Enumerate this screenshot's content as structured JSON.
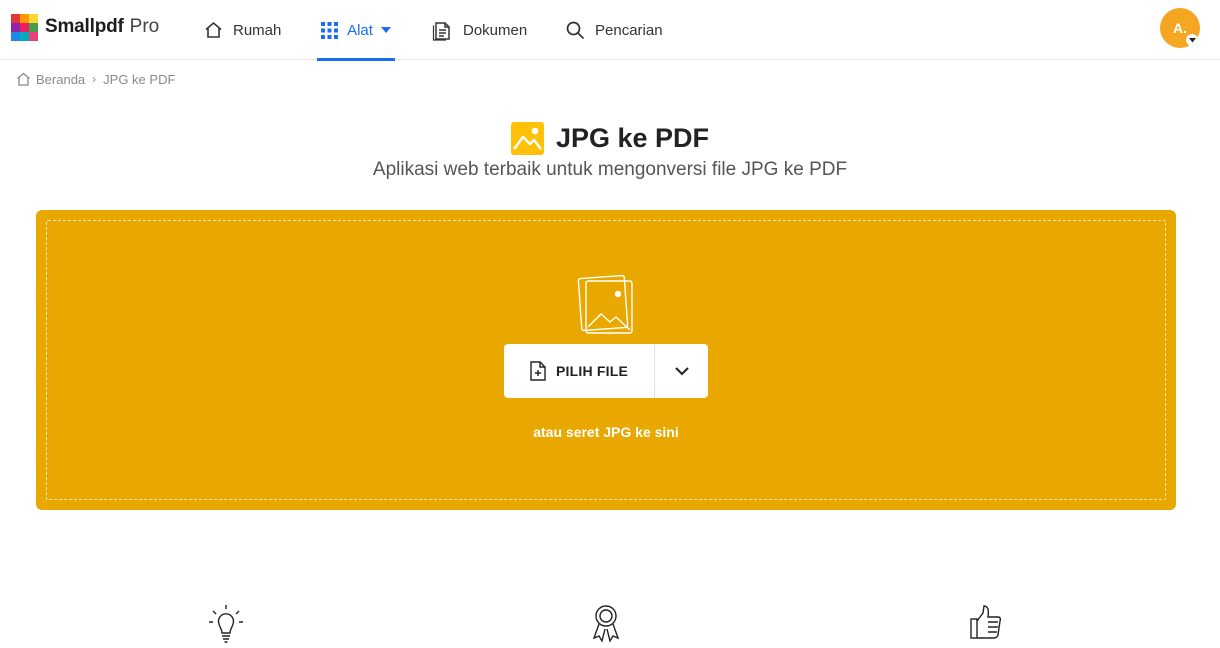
{
  "brand": {
    "name": "Smallpdf",
    "tier": "Pro"
  },
  "nav": {
    "items": [
      {
        "label": "Rumah",
        "icon": "home-icon"
      },
      {
        "label": "Alat",
        "icon": "grid-icon",
        "active": true
      },
      {
        "label": "Dokumen",
        "icon": "documents-icon"
      },
      {
        "label": "Pencarian",
        "icon": "search-icon"
      }
    ]
  },
  "user": {
    "initials": "A."
  },
  "breadcrumb": {
    "home": "Beranda",
    "separator": "›",
    "current": "JPG ke PDF"
  },
  "page": {
    "title": "JPG ke PDF",
    "subtitle": "Aplikasi web terbaik untuk mengonversi file JPG ke PDF"
  },
  "dropzone": {
    "choose_label": "PILIH FILE",
    "hint": "atau seret JPG ke sini"
  },
  "features": [
    {
      "icon": "lightbulb-icon"
    },
    {
      "icon": "award-icon"
    },
    {
      "icon": "thumbs-up-icon"
    }
  ],
  "colors": {
    "accent": "#e8a800",
    "nav_active": "#1a6ef5",
    "avatar": "#f5a623",
    "tool_icon": "#ffc107"
  }
}
